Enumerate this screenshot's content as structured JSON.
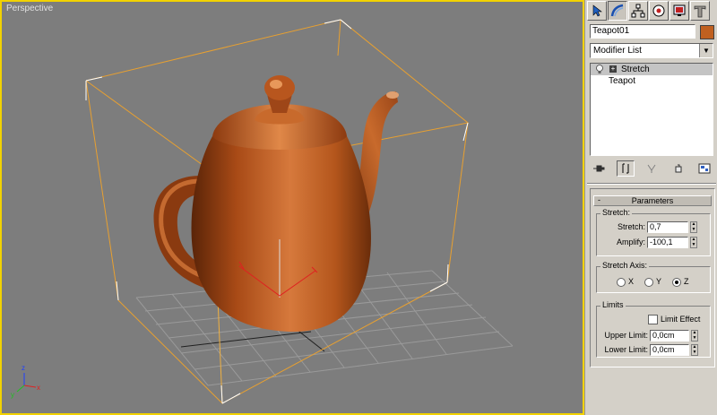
{
  "viewport": {
    "label": "Perspective",
    "border_color": "#f2d200",
    "background": "#7d7d7d",
    "object_color": "#c96a2a"
  },
  "panel": {
    "tabs": [
      {
        "icon": "pointer-icon"
      },
      {
        "icon": "modify-icon"
      },
      {
        "icon": "hierarchy-icon"
      },
      {
        "icon": "motion-icon"
      },
      {
        "icon": "display-icon"
      },
      {
        "icon": "utilities-icon"
      }
    ],
    "object_name": "Teapot01",
    "object_color": "#c06020",
    "modifier_list_label": "Modifier List",
    "stack": [
      {
        "label": "Stretch",
        "selected": true
      },
      {
        "label": "Teapot",
        "selected": false
      }
    ],
    "stack_tools": [
      "pin-icon",
      "show-end-result-icon",
      "make-unique-icon",
      "remove-modifier-icon",
      "configure-sets-icon"
    ],
    "rollout": {
      "title": "Parameters",
      "stretch_group": {
        "title": "Stretch:",
        "stretch_label": "Stretch:",
        "stretch_value": "0,7",
        "amplify_label": "Amplify:",
        "amplify_value": "-100,1"
      },
      "axis_group": {
        "title": "Stretch Axis:",
        "options": [
          "X",
          "Y",
          "Z"
        ],
        "selected": "Z"
      },
      "limits_group": {
        "title": "Limits",
        "limit_effect_label": "Limit Effect",
        "limit_effect_checked": false,
        "upper_label": "Upper Limit:",
        "upper_value": "0,0cm",
        "lower_label": "Lower Limit:",
        "lower_value": "0,0cm"
      }
    }
  }
}
